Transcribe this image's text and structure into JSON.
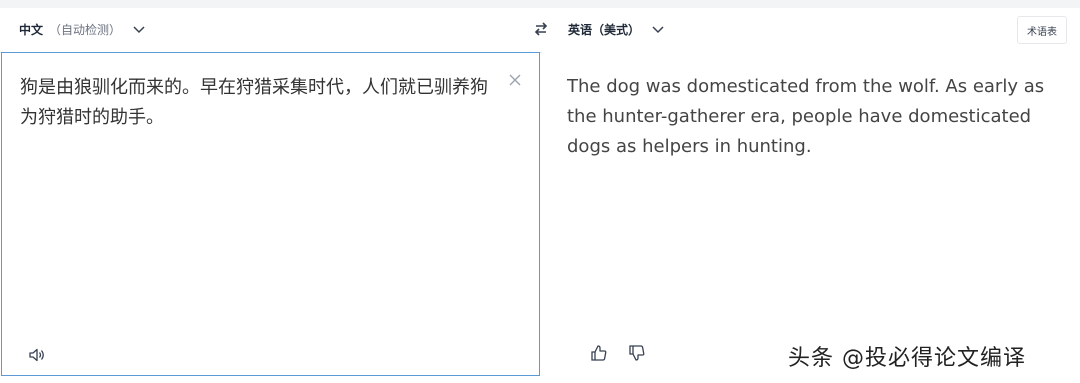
{
  "source_language": {
    "name": "中文",
    "detect_label": "（自动检测）"
  },
  "target_language": {
    "name": "英语（美式）"
  },
  "glossary_button": "术语表",
  "source_text": "狗是由狼驯化而来的。早在狩猎采集时代，人们就已驯养狗为狩猎时的助手。",
  "translation_text": "The dog was domesticated from the wolf. As early as the hunter-gatherer era, people have domesticated dogs as helpers in hunting.",
  "watermark": "头条 @投必得论文编译",
  "icons": {
    "swap": "swap-arrows-icon",
    "clear": "close-icon",
    "speaker": "speaker-icon",
    "like": "thumbs-up-icon",
    "dislike": "thumbs-down-icon",
    "dropdown": "chevron-down-icon"
  },
  "colors": {
    "focus_border": "#5b9bd5",
    "text": "#333333"
  }
}
